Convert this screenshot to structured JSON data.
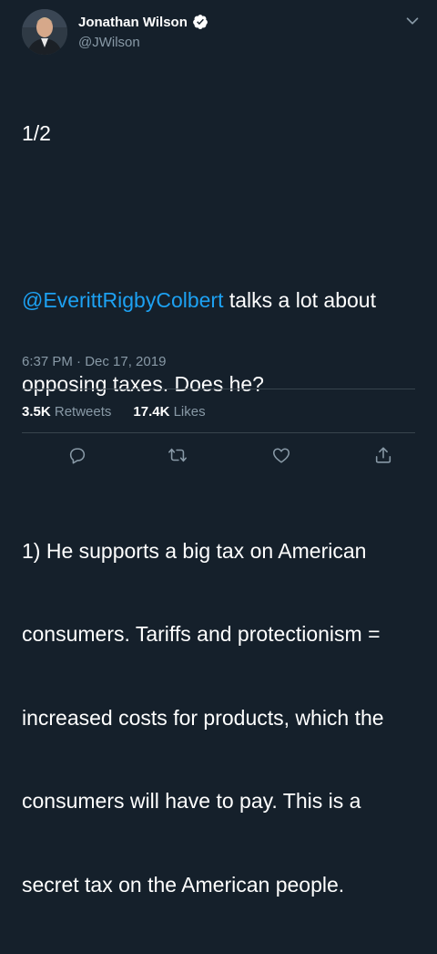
{
  "user": {
    "display_name": "Jonathan Wilson",
    "handle": "@JWilson",
    "verified": true
  },
  "tweet": {
    "lines": [
      {
        "text": "1/2"
      },
      {
        "text": ""
      },
      {
        "mention": "@EverittRigbyColbert",
        "text": " talks a lot about"
      },
      {
        "text": "opposing taxes. Does he?"
      },
      {
        "text": ""
      },
      {
        "text": "1) He supports a big tax on American"
      },
      {
        "text": "consumers. Tariffs and protectionism ="
      },
      {
        "text": "increased costs for products, which the"
      },
      {
        "text": "consumers will have to pay. This is a"
      },
      {
        "text": "secret tax on the American people."
      }
    ],
    "timestamp": "6:37 PM · Dec 17, 2019"
  },
  "stats": {
    "retweets_count": "3.5K",
    "retweets_label": "Retweets",
    "likes_count": "17.4K",
    "likes_label": "Likes"
  },
  "actions": [
    "reply-icon",
    "retweet-icon",
    "like-icon",
    "share-icon"
  ],
  "colors": {
    "background": "#15202b",
    "link": "#1da1f2",
    "muted": "#8899a6",
    "divider": "#38444d",
    "verified_badge": "#ffffff"
  }
}
